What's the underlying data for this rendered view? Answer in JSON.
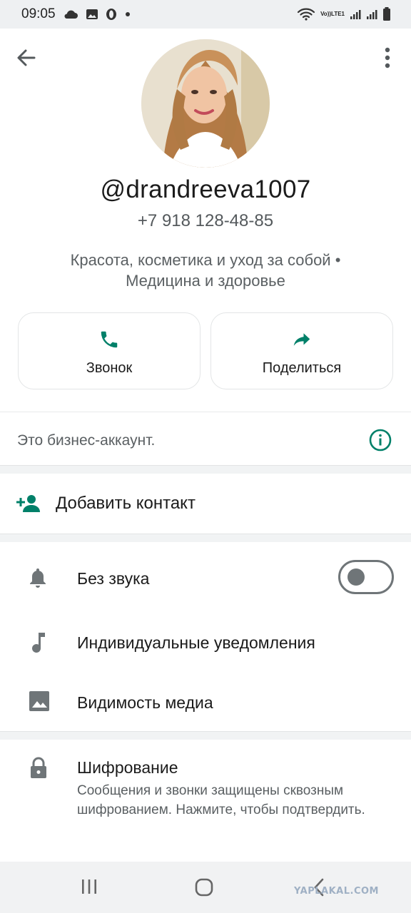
{
  "status_bar": {
    "time": "09:05",
    "left_icons": [
      "cloud-icon",
      "image-icon",
      "opera-icon",
      "dot-icon"
    ],
    "right_icons": [
      "wifi-icon",
      "volte-icon",
      "signal-icon",
      "signal-icon",
      "battery-icon"
    ],
    "volte_label_top": "Vo))",
    "volte_label_bottom": "LTE1"
  },
  "header": {
    "back_icon": "arrow-left-icon",
    "more_icon": "more-vertical-icon"
  },
  "profile": {
    "username": "@drandreeva1007",
    "phone": "+7 918 128-48-85",
    "categories": "Красота, косметика и уход за собой • Медицина и здоровье"
  },
  "actions": [
    {
      "label": "Звонок",
      "icon": "phone-icon"
    },
    {
      "label": "Поделиться",
      "icon": "share-icon"
    }
  ],
  "business": {
    "text": "Это бизнес-аккаунт.",
    "icon": "info-icon"
  },
  "add_contact": {
    "label": "Добавить контакт",
    "icon": "add-person-icon"
  },
  "settings": [
    {
      "label": "Без звука",
      "icon": "bell-icon",
      "toggle": false
    },
    {
      "label": "Индивидуальные уведомления",
      "icon": "music-note-icon"
    },
    {
      "label": "Видимость медиа",
      "icon": "image-icon"
    }
  ],
  "encryption": {
    "title": "Шифрование",
    "subtitle": "Сообщения и звонки защищены сквозным шифрованием. Нажмите, чтобы подтвердить.",
    "icon": "lock-icon"
  },
  "watermark": "YAPLAKAL.COM",
  "colors": {
    "accent": "#008069",
    "icon_gray": "#6f7578",
    "text_primary": "#1b1b1b",
    "text_secondary": "#5a5f62"
  }
}
